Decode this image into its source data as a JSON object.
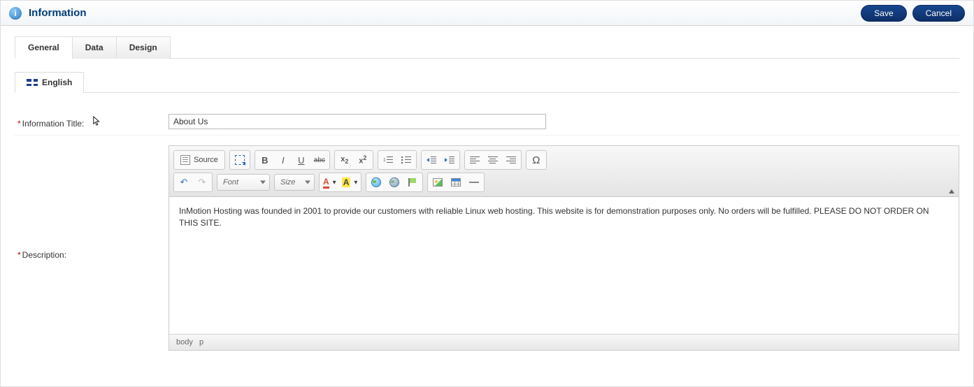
{
  "header": {
    "title": "Information",
    "icon_glyph": "i"
  },
  "actions": {
    "save": "Save",
    "cancel": "Cancel"
  },
  "tabs": {
    "general": "General",
    "data": "Data",
    "design": "Design"
  },
  "language_tab": "English",
  "form": {
    "title_label": "Information Title:",
    "title_value": "About Us",
    "description_label": "Description:"
  },
  "editor": {
    "source_label": "Source",
    "font_dropdown": "Font",
    "size_dropdown": "Size",
    "textcolor_letter": "A",
    "bgcolor_letter": "A",
    "content": "InMotion Hosting was founded in 2001 to provide our customers with reliable Linux web hosting. This website is for demonstration purposes only. No orders will be fulfilled. PLEASE DO NOT ORDER ON THIS SITE.",
    "status_path": [
      "body",
      "p"
    ]
  }
}
